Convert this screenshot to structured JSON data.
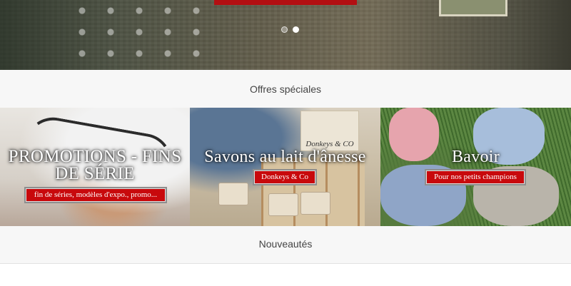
{
  "hero": {
    "slide_count": 2,
    "active_slide": 2
  },
  "offers_section": {
    "title": "Offres spéciales",
    "tiles": [
      {
        "title": "PROMOTIONS - FINS DE SÉRIE",
        "button": "fin de séries, modèles d'expo., promo..."
      },
      {
        "title": "Savons au lait d'ânesse",
        "button": "Donkeys & Co",
        "image_label": "Donkeys & CO"
      },
      {
        "title": "Bavoir",
        "button": "Pour nos petits champions"
      }
    ]
  },
  "new_section": {
    "title": "Nouveautés"
  },
  "colors": {
    "accent_red": "#c8090c",
    "page_bg": "#f7f7f7"
  }
}
